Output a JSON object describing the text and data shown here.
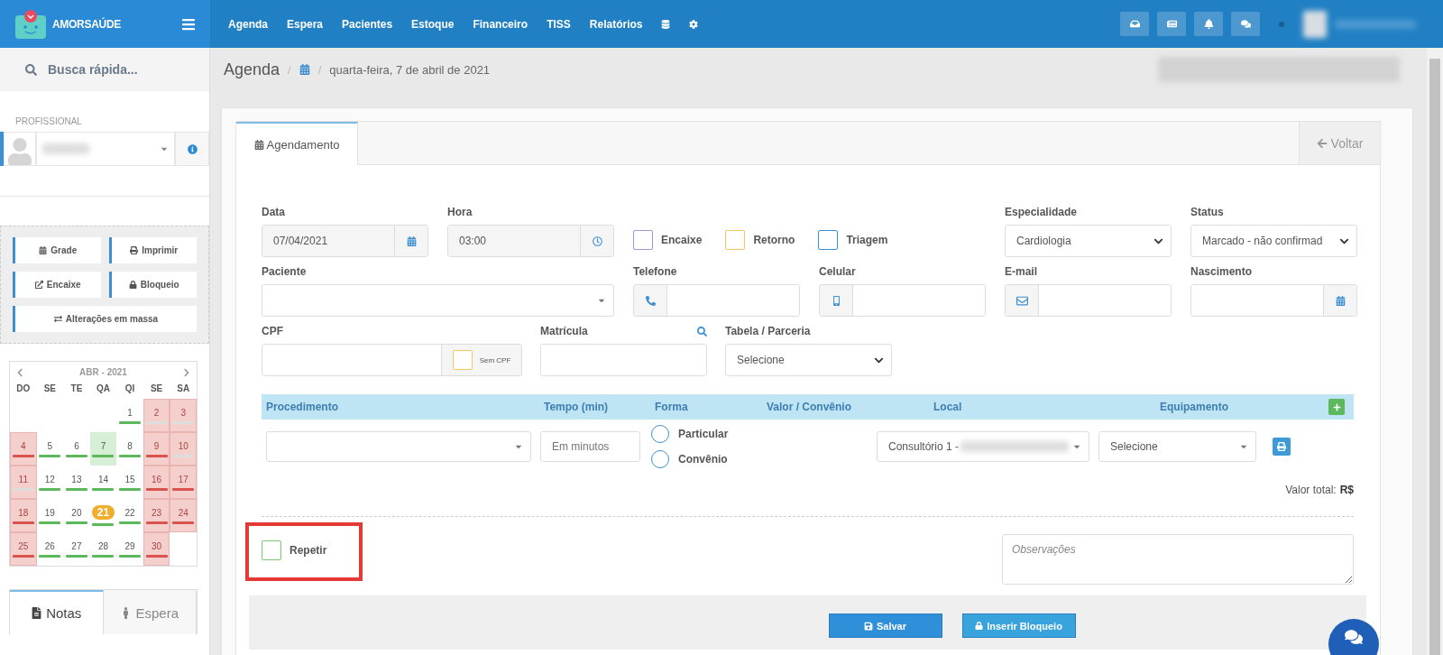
{
  "topbar": {
    "brand": "AMORSAÚDE",
    "nav": [
      "Agenda",
      "Espera",
      "Pacientes",
      "Estoque",
      "Financeiro",
      "TISS",
      "Relatórios"
    ]
  },
  "sidebar": {
    "search": "Busca rápida...",
    "professional_label": "PROFISSIONAL",
    "actions": [
      "Grade",
      "Imprimir",
      "Encaixe",
      "Bloqueio",
      "Alterações em massa"
    ],
    "calendar": {
      "title": "ABR - 2021",
      "weekdays": [
        "DO",
        "SE",
        "TE",
        "QA",
        "QI",
        "SE",
        "SA"
      ],
      "weeks": [
        [
          {
            "day": "1",
            "closed": false,
            "selected": false,
            "today": false,
            "color": "#5cb85c"
          },
          {
            "day": "2",
            "closed": true,
            "selected": false,
            "today": false,
            "color": "#dddddd"
          },
          {
            "day": "3",
            "closed": true,
            "selected": false,
            "today": false,
            "color": "#dddddd"
          }
        ],
        [
          {
            "day": "4",
            "closed": true,
            "selected": false,
            "today": false,
            "color": "#d9534f"
          },
          {
            "day": "5",
            "closed": false,
            "selected": false,
            "today": false,
            "color": "#5cb85c"
          },
          {
            "day": "6",
            "closed": false,
            "selected": false,
            "today": false,
            "color": "#5cb85c"
          },
          {
            "day": "7",
            "closed": false,
            "selected": true,
            "today": false,
            "color": "#5cb85c"
          },
          {
            "day": "8",
            "closed": false,
            "selected": false,
            "today": false,
            "color": "#5cb85c"
          },
          {
            "day": "9",
            "closed": true,
            "selected": false,
            "today": false,
            "color": "#d9534f"
          },
          {
            "day": "10",
            "closed": true,
            "selected": false,
            "today": false,
            "color": "#dddddd"
          }
        ],
        [
          {
            "day": "11",
            "closed": true,
            "selected": false,
            "today": false,
            "color": "#dddddd"
          },
          {
            "day": "12",
            "closed": false,
            "selected": false,
            "today": false,
            "color": "#5cb85c"
          },
          {
            "day": "13",
            "closed": false,
            "selected": false,
            "today": false,
            "color": "#5cb85c"
          },
          {
            "day": "14",
            "closed": false,
            "selected": false,
            "today": false,
            "color": "#5cb85c"
          },
          {
            "day": "15",
            "closed": false,
            "selected": false,
            "today": false,
            "color": "#5cb85c"
          },
          {
            "day": "16",
            "closed": true,
            "selected": false,
            "today": false,
            "color": "#d9534f"
          },
          {
            "day": "17",
            "closed": true,
            "selected": false,
            "today": false,
            "color": "#d9534f"
          }
        ],
        [
          {
            "day": "18",
            "closed": true,
            "selected": false,
            "today": false,
            "color": "#d9534f"
          },
          {
            "day": "19",
            "closed": false,
            "selected": false,
            "today": false,
            "color": "#5cb85c"
          },
          {
            "day": "20",
            "closed": false,
            "selected": false,
            "today": false,
            "color": "#5cb85c"
          },
          {
            "day": "21",
            "closed": false,
            "selected": false,
            "today": true,
            "color": "#5cb85c"
          },
          {
            "day": "22",
            "closed": false,
            "selected": false,
            "today": false,
            "color": "#5cb85c"
          },
          {
            "day": "23",
            "closed": true,
            "selected": false,
            "today": false,
            "color": "#d9534f"
          },
          {
            "day": "24",
            "closed": true,
            "selected": false,
            "today": false,
            "color": "#d9534f"
          }
        ],
        [
          {
            "day": "25",
            "closed": true,
            "selected": false,
            "today": false,
            "color": "#d9534f"
          },
          {
            "day": "26",
            "closed": false,
            "selected": false,
            "today": false,
            "color": "#5cb85c"
          },
          {
            "day": "27",
            "closed": false,
            "selected": false,
            "today": false,
            "color": "#5cb85c"
          },
          {
            "day": "28",
            "closed": false,
            "selected": false,
            "today": false,
            "color": "#5cb85c"
          },
          {
            "day": "29",
            "closed": false,
            "selected": false,
            "today": false,
            "color": "#5cb85c"
          },
          {
            "day": "30",
            "closed": true,
            "selected": false,
            "today": false,
            "color": "#d9534f"
          }
        ]
      ]
    },
    "tabs": [
      {
        "label": "Notas",
        "selected": true
      },
      {
        "label": "Espera",
        "selected": false
      }
    ]
  },
  "breadcrumb": {
    "title": "Agenda",
    "separators": [
      "/",
      "/"
    ],
    "date": "quarta-feira, 7 de abril de 2021"
  },
  "panel": {
    "tabs": [
      {
        "label": "Agendamento",
        "selected": true
      }
    ],
    "back": "Voltar"
  },
  "form": {
    "data": {
      "label": "Data",
      "value": "07/04/2021"
    },
    "hora": {
      "label": "Hora",
      "value": "03:00"
    },
    "flags": [
      {
        "label": "Encaixe",
        "checked": false,
        "color": "#a592d6"
      },
      {
        "label": "Retorno",
        "checked": false,
        "color": "#f0c75e"
      },
      {
        "label": "Triagem",
        "checked": false,
        "color": "#3d8fd1"
      }
    ],
    "especialidade": {
      "label": "Especialidade",
      "value": "Cardiologia"
    },
    "status": {
      "label": "Status",
      "value": "Marcado - não confirmad"
    },
    "paciente": {
      "label": "Paciente"
    },
    "telefone": {
      "label": "Telefone"
    },
    "celular": {
      "label": "Celular"
    },
    "email": {
      "label": "E-mail"
    },
    "nascimento": {
      "label": "Nascimento"
    },
    "cpf": {
      "label": "CPF",
      "no_cpf": "Sem CPF",
      "checked": false
    },
    "matricula": {
      "label": "Matrícula"
    },
    "tabela": {
      "label": "Tabela / Parceria",
      "value": "Selecione"
    },
    "procedures": {
      "columns": [
        "Procedimento",
        "Tempo (min)",
        "Forma",
        "Valor / Convênio",
        "Local",
        "Equipamento"
      ],
      "row": {
        "tempo_placeholder": "Em minutos",
        "forma": [
          {
            "label": "Particular",
            "selected": false
          },
          {
            "label": "Convênio",
            "selected": false
          }
        ],
        "local": "Consultório 1 -",
        "equipamento": "Selecione"
      }
    },
    "total_label": "Valor total:",
    "total_value": "R$",
    "repetir": {
      "label": "Repetir",
      "checked": false
    },
    "observacoes": {
      "placeholder": "Observações"
    },
    "buttons": [
      "Salvar",
      "Inserir Bloqueio"
    ]
  }
}
